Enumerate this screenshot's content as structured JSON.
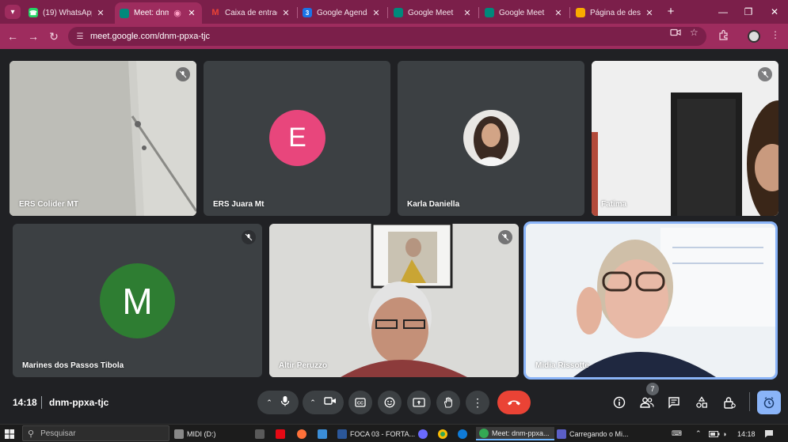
{
  "browser": {
    "tabs": [
      {
        "label": "(19) WhatsApp",
        "favicon": "whatsapp-icon",
        "color": "#25d366",
        "active": false
      },
      {
        "label": "Meet: dnm-p",
        "favicon": "meet-icon",
        "color": "#00897b",
        "active": true
      },
      {
        "label": "Caixa de entrad",
        "favicon": "gmail-icon",
        "color": "#ea4335",
        "active": false
      },
      {
        "label": "Google Agenda",
        "favicon": "calendar-icon",
        "color": "#1a73e8",
        "active": false
      },
      {
        "label": "Google Meet",
        "favicon": "meet-icon",
        "color": "#00897b",
        "active": false
      },
      {
        "label": "Google Meet",
        "favicon": "meet-icon",
        "color": "#00897b",
        "active": false
      },
      {
        "label": "Página de destin",
        "favicon": "page-icon",
        "color": "#f9ab00",
        "active": false
      }
    ],
    "url": "meet.google.com/dnm-ppxa-tjc",
    "theme_color": "#9e2c5e"
  },
  "participants": [
    {
      "name": "ERS Colider MT",
      "muted": true
    },
    {
      "name": "ERS Juara Mt",
      "initial": "E",
      "avatar_color": "#e8467c",
      "muted": false
    },
    {
      "name": "Karla Daniella",
      "muted": false
    },
    {
      "name": "Fatima",
      "muted": true
    },
    {
      "name": "Marines dos Passos Tibola",
      "initial": "M",
      "avatar_color": "#2e7d32",
      "muted": true
    },
    {
      "name": "Altir Peruzzo",
      "muted": true
    },
    {
      "name": "Midia Rissotte",
      "muted": false
    }
  ],
  "meeting": {
    "time": "14:18",
    "code": "dnm-ppxa-tjc",
    "people_count": "7",
    "end_call_color": "#ea4335",
    "host_control_color": "#8ab4f8"
  },
  "taskbar": {
    "search_placeholder": "Pesquisar",
    "items": [
      {
        "label": "MIDI (D:)"
      },
      {
        "label": "FOCA 03 - FORTA..."
      },
      {
        "label": "Meet: dnm-ppxa..."
      },
      {
        "label": "Carregando o Mi..."
      }
    ],
    "clock": "14:18"
  }
}
